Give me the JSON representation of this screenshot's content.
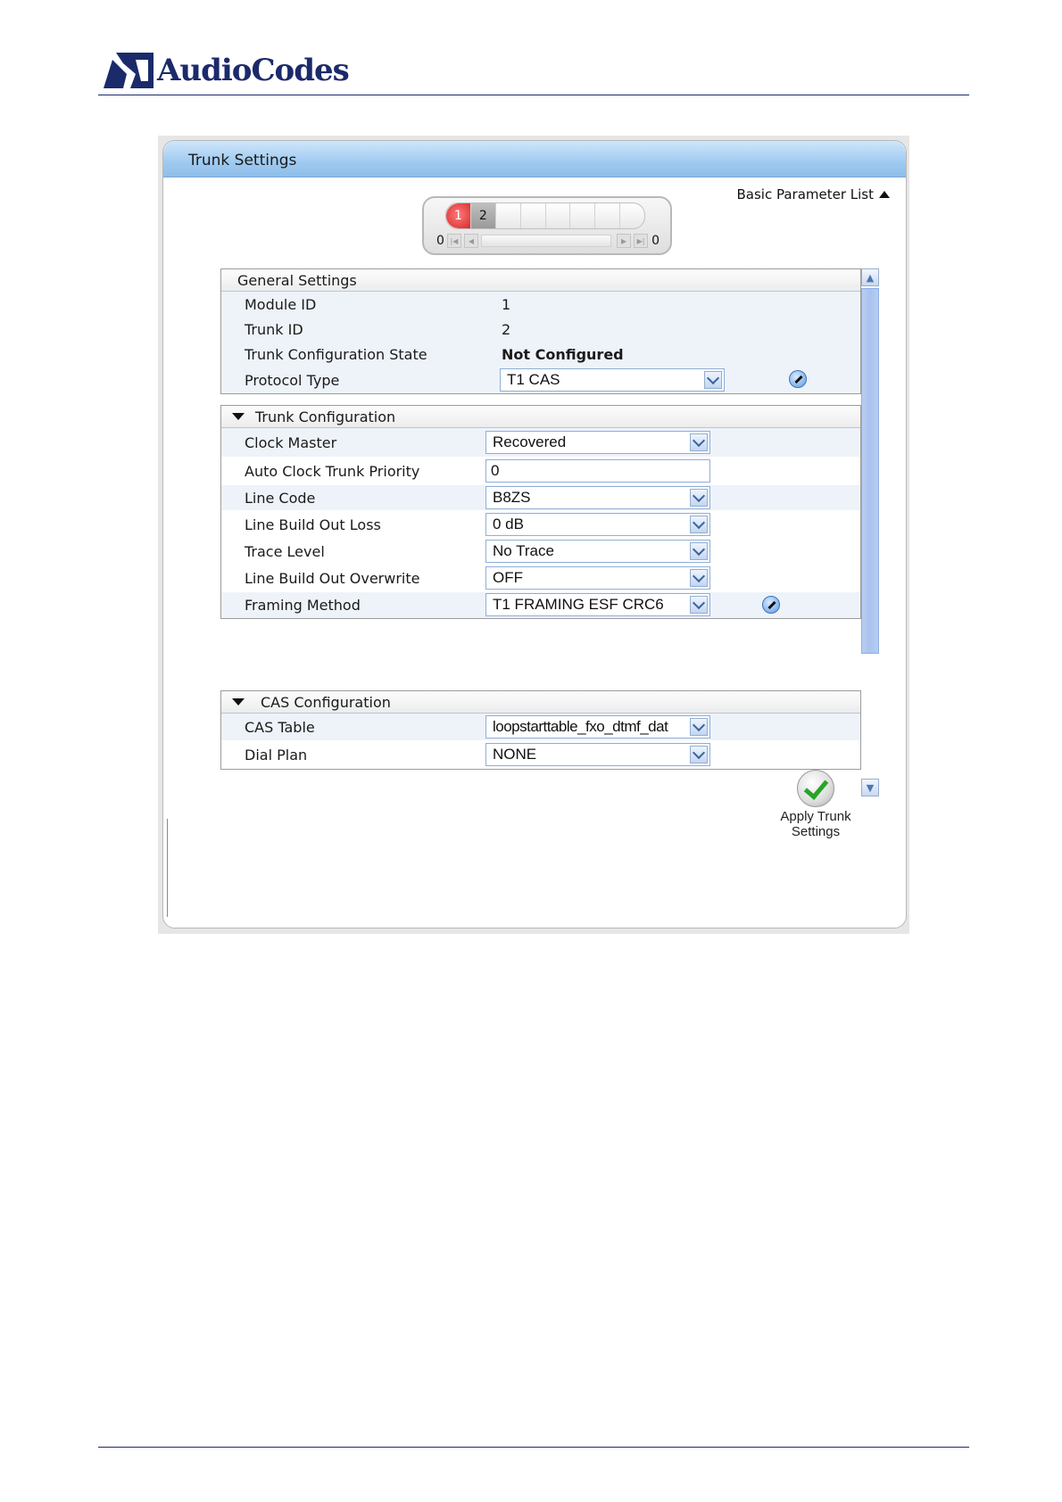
{
  "brand": {
    "name": "AudioCodes"
  },
  "panel": {
    "title": "Trunk Settings",
    "basic_parameter_list": "Basic Parameter List",
    "trunk_nav": {
      "trunks": [
        "1",
        "2",
        "",
        "",
        "",
        "",
        "",
        ""
      ],
      "left_count": "0",
      "right_count": "0"
    }
  },
  "general_settings": {
    "title": "General Settings",
    "module_id_label": "Module ID",
    "module_id": "1",
    "trunk_id_label": "Trunk ID",
    "trunk_id": "2",
    "state_label": "Trunk Configuration State",
    "state": "Not Configured",
    "protocol_label": "Protocol Type",
    "protocol": "T1 CAS"
  },
  "trunk_configuration": {
    "title": "Trunk Configuration",
    "rows": [
      {
        "label": "Clock Master",
        "value": "Recovered",
        "type": "select"
      },
      {
        "label": "Auto Clock Trunk Priority",
        "value": "0",
        "type": "text"
      },
      {
        "label": "Line Code",
        "value": "B8ZS",
        "type": "select"
      },
      {
        "label": "Line Build Out Loss",
        "value": "0 dB",
        "type": "select"
      },
      {
        "label": "Trace Level",
        "value": "No Trace",
        "type": "select"
      },
      {
        "label": "Line Build Out Overwrite",
        "value": "OFF",
        "type": "select"
      },
      {
        "label": "Framing Method",
        "value": "T1 FRAMING ESF CRC6",
        "type": "select"
      }
    ]
  },
  "cas_configuration": {
    "title": "CAS Configuration",
    "rows": [
      {
        "label": "CAS Table",
        "value": "loopstarttable_fxo_dtmf_dat"
      },
      {
        "label": "Dial Plan",
        "value": "NONE"
      }
    ]
  },
  "apply": {
    "line1": "Apply Trunk",
    "line2": "Settings"
  },
  "colors": {
    "header_blue": "#9fcaf0",
    "brand_navy": "#1b2a6b",
    "accent_red": "#d62b2b",
    "check_green": "#26a526"
  }
}
